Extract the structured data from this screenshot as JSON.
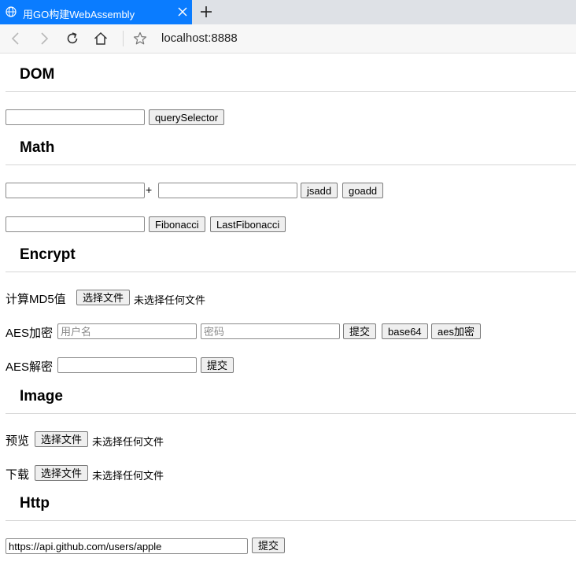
{
  "browser": {
    "tab_title": "用GO构建WebAssembly",
    "url": "localhost:8888"
  },
  "sections": {
    "dom": {
      "title": "DOM",
      "query_button": "querySelector"
    },
    "math": {
      "title": "Math",
      "plus": "+",
      "jsadd_button": "jsadd",
      "goadd_button": "goadd",
      "fibonacci_button": "Fibonacci",
      "last_fibonacci_button": "LastFibonacci"
    },
    "encrypt": {
      "title": "Encrypt",
      "md5_label": "计算MD5值",
      "choose_file_button": "选择文件",
      "no_file_text": "未选择任何文件",
      "aes_encrypt_label": "AES加密",
      "username_placeholder": "用户名",
      "password_placeholder": "密码",
      "submit_button": "提交",
      "base64_button": "base64",
      "aes_encrypt_button": "aes加密",
      "aes_decrypt_label": "AES解密"
    },
    "image": {
      "title": "Image",
      "preview_label": "预览",
      "download_label": "下载",
      "choose_file_button": "选择文件",
      "no_file_text": "未选择任何文件"
    },
    "http": {
      "title": "Http",
      "url_value": "https://api.github.com/users/apple",
      "submit_button": "提交"
    }
  },
  "icons": {
    "tab": "globe-icon",
    "close": "close-icon",
    "new_tab": "plus-icon",
    "back": "back-arrow-icon",
    "forward": "forward-arrow-icon",
    "reload": "reload-icon",
    "home": "home-icon",
    "favorite": "star-icon"
  },
  "colors": {
    "active_tab": "#0a7cff",
    "tab_strip": "#dee1e6"
  }
}
